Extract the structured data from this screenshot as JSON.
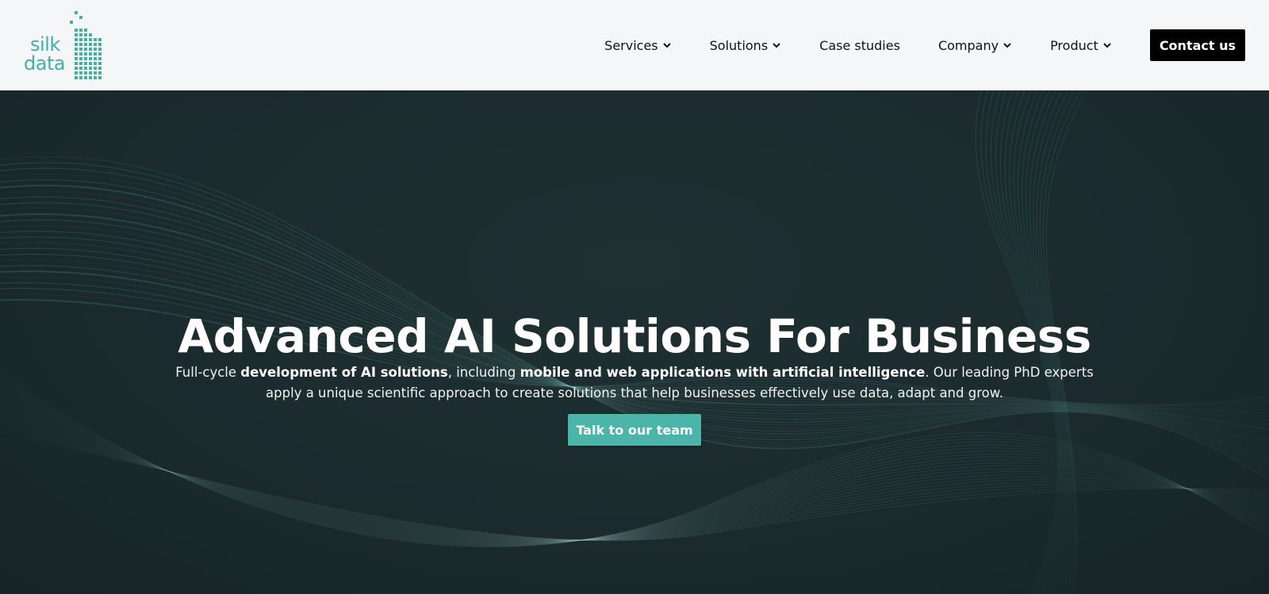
{
  "logo": {
    "line1": "silk",
    "line2": "data",
    "color": "#3fb2a4"
  },
  "nav": {
    "items": [
      {
        "label": "Services",
        "dropdown": true
      },
      {
        "label": "Solutions",
        "dropdown": true
      },
      {
        "label": "Case studies",
        "dropdown": false
      },
      {
        "label": "Company",
        "dropdown": true
      },
      {
        "label": "Product",
        "dropdown": true
      }
    ],
    "contact_label": "Contact us"
  },
  "hero": {
    "title": "Advanced AI Solutions For Business",
    "sub_parts": [
      "Full-cycle ",
      "development of AI solutions",
      ", including ",
      "mobile and web applications with artificial intelligence",
      ". Our leading PhD experts apply a unique scientific approach to create solutions that help businesses effectively use data, adapt and grow."
    ],
    "cta_label": "Talk to our team"
  },
  "colors": {
    "accent": "#4ab5a8",
    "header_bg": "#f5f6f8",
    "hero_bg": "#1b2a2c"
  }
}
